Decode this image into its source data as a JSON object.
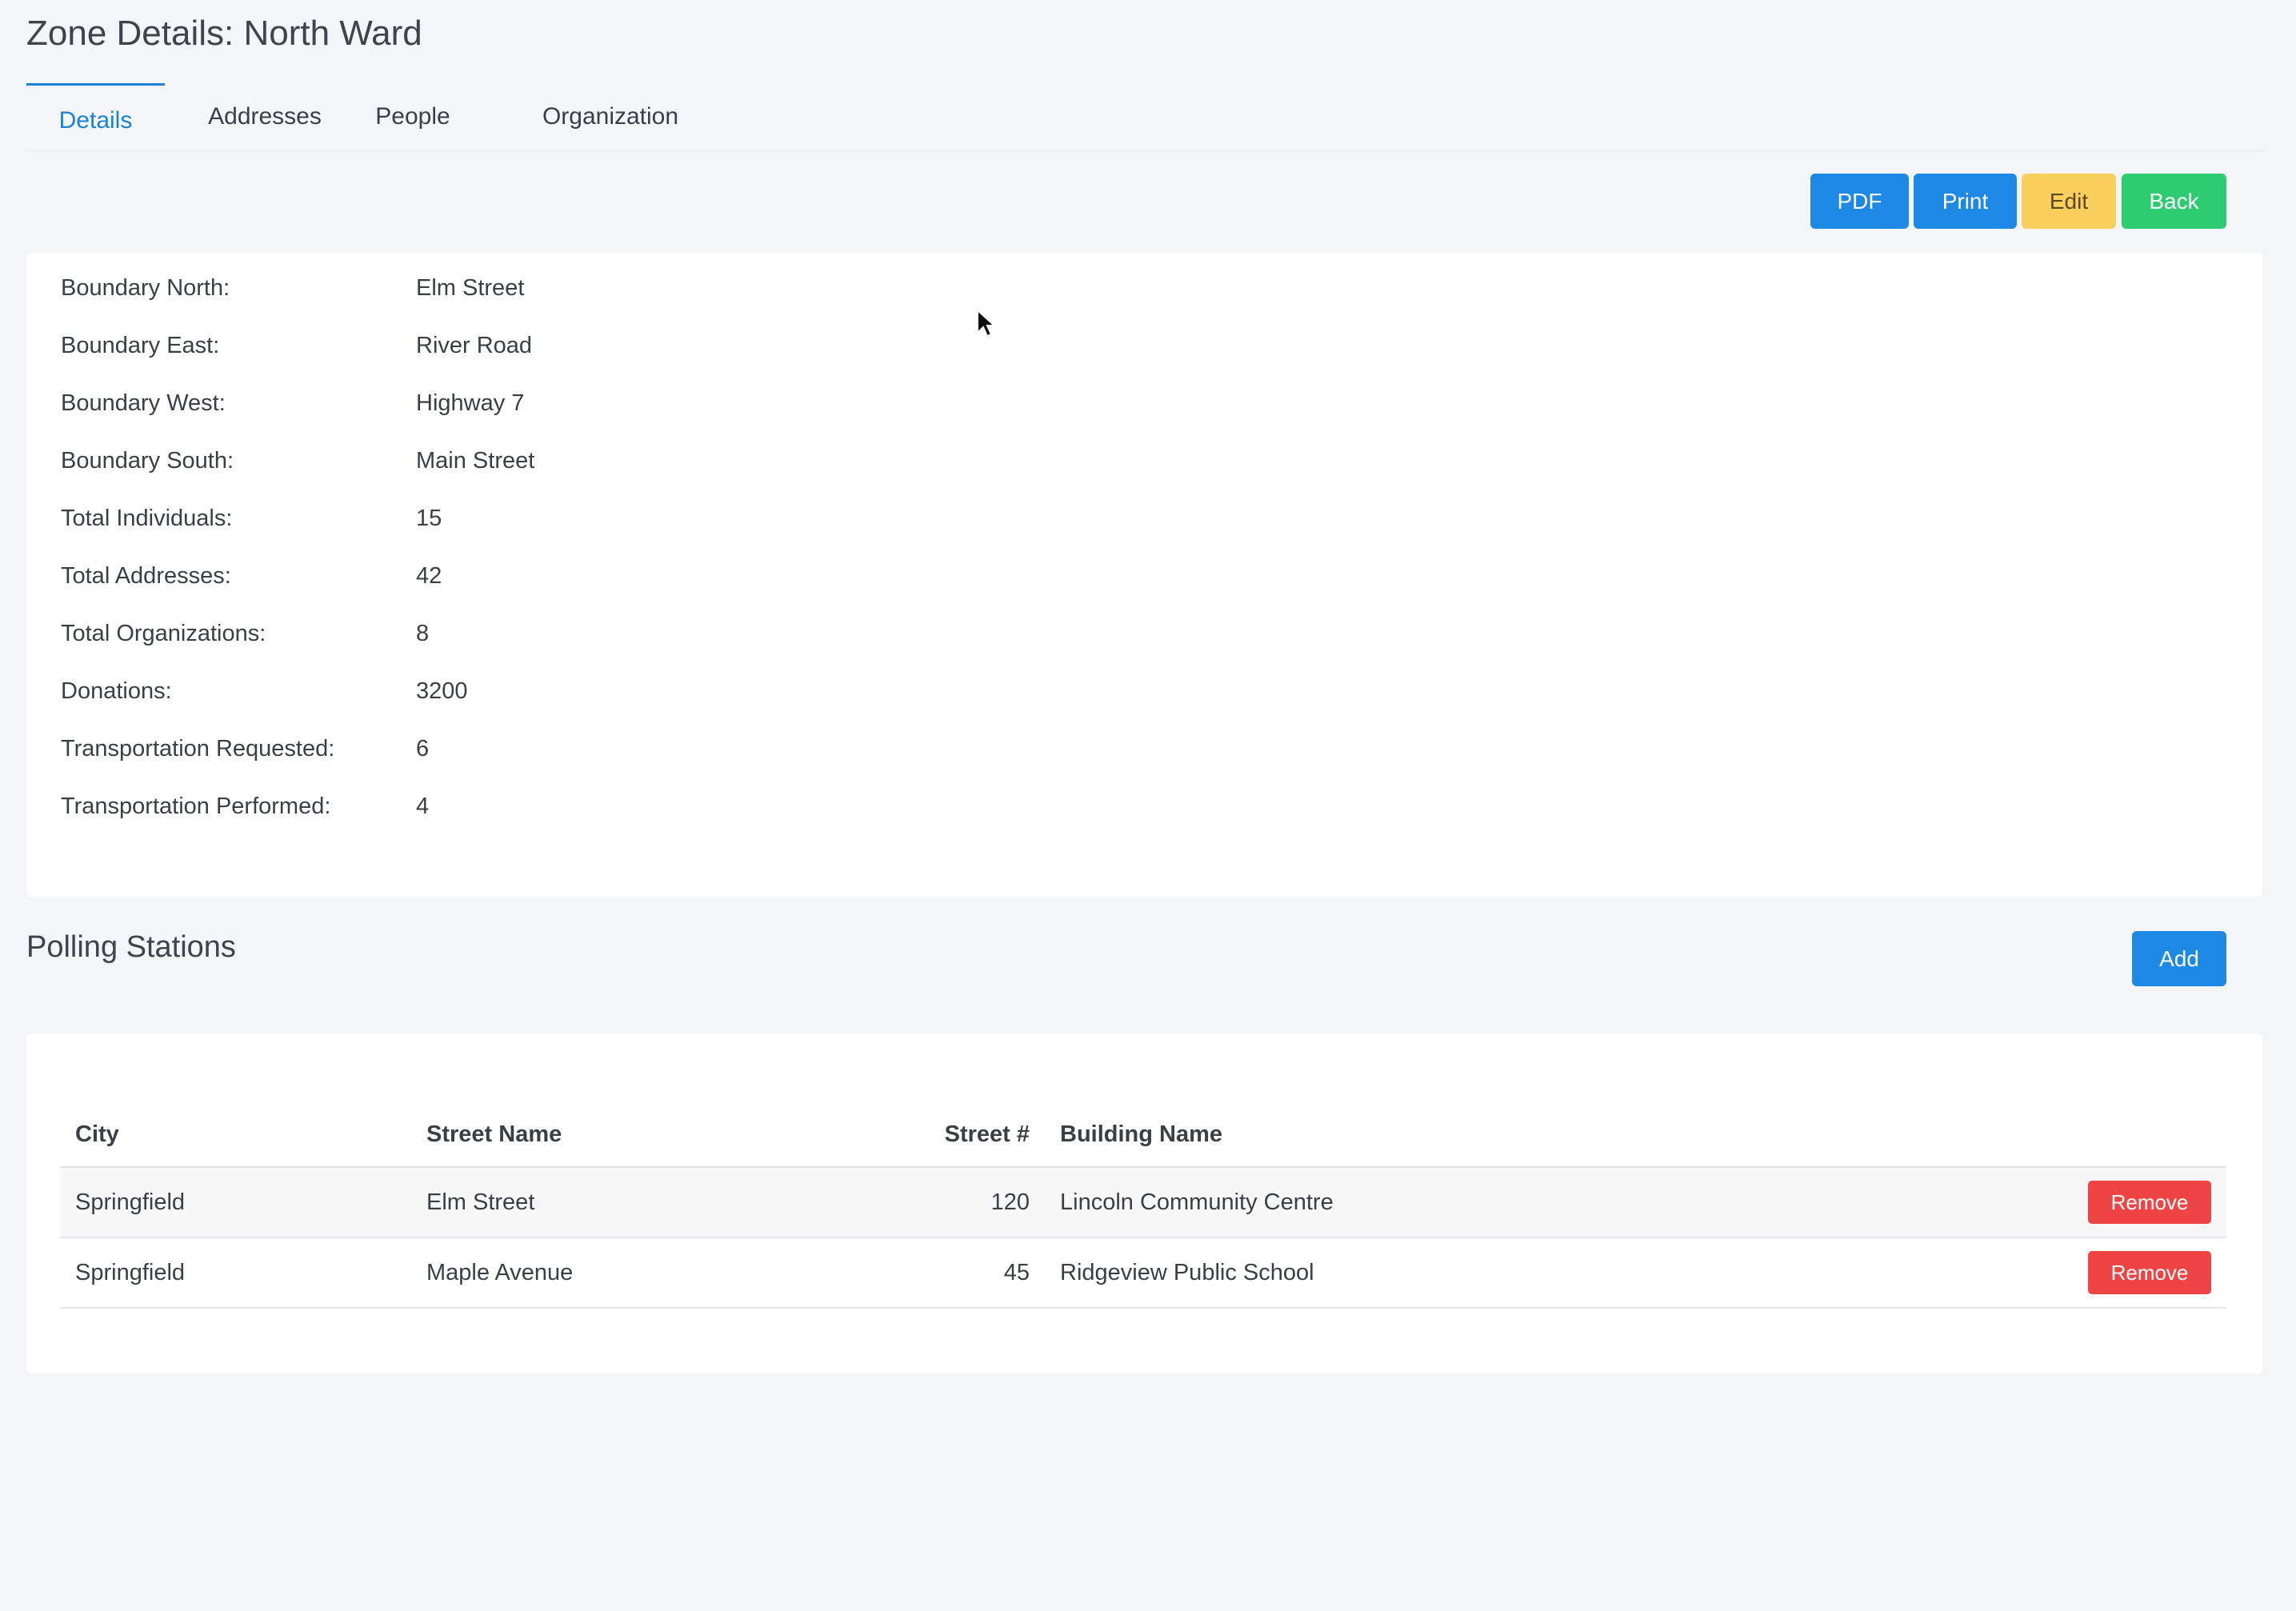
{
  "page": {
    "title": "Zone Details: North Ward"
  },
  "tabs": [
    {
      "label": "Details",
      "active": true
    },
    {
      "label": "Addresses",
      "active": false
    },
    {
      "label": "People",
      "active": false
    },
    {
      "label": "Organization",
      "active": false
    }
  ],
  "toolbar": {
    "pdf_label": "PDF",
    "print_label": "Print",
    "edit_label": "Edit",
    "back_label": "Back"
  },
  "details": [
    {
      "label": "Boundary North:",
      "value": "Elm Street"
    },
    {
      "label": "Boundary East:",
      "value": "River Road"
    },
    {
      "label": "Boundary West:",
      "value": "Highway 7"
    },
    {
      "label": "Boundary South:",
      "value": "Main Street"
    },
    {
      "label": "Total Individuals:",
      "value": "15"
    },
    {
      "label": "Total Addresses:",
      "value": "42"
    },
    {
      "label": "Total Organizations:",
      "value": "8"
    },
    {
      "label": "Donations:",
      "value": "3200"
    },
    {
      "label": "Transportation Requested:",
      "value": "6"
    },
    {
      "label": "Transportation Performed:",
      "value": "4"
    }
  ],
  "polling": {
    "title": "Polling Stations",
    "add_label": "Add",
    "columns": [
      "City",
      "Street Name",
      "Street #",
      "Building Name"
    ],
    "rows": [
      {
        "city": "Springfield",
        "street_name": "Elm Street",
        "street_no": "120",
        "building": "Lincoln Community Centre",
        "action": "Remove"
      },
      {
        "city": "Springfield",
        "street_name": "Maple Avenue",
        "street_no": "45",
        "building": "Ridgeview Public School",
        "action": "Remove"
      }
    ]
  },
  "colors": {
    "primary": "#1e88e5",
    "warning": "#fbcf5e",
    "success": "#2ecc71",
    "danger": "#ef4444",
    "background": "#f4f5f7"
  },
  "icons": {
    "cursor": "mouse-pointer-icon"
  }
}
